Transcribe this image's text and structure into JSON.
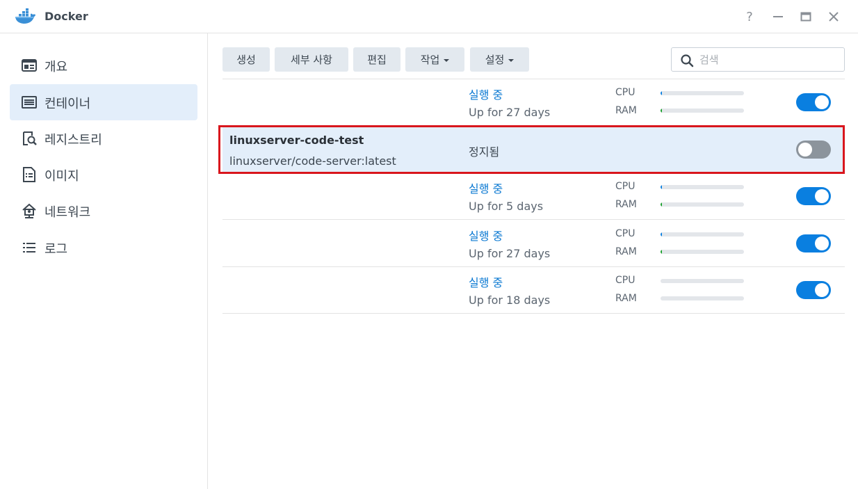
{
  "window": {
    "title": "Docker",
    "help_symbol": "?",
    "icons": [
      "docker-icon",
      "help-icon",
      "minimize-icon",
      "maximize-icon",
      "close-icon"
    ]
  },
  "sidebar": {
    "items": [
      {
        "label": "개요",
        "icon": "overview-icon",
        "active": false
      },
      {
        "label": "컨테이너",
        "icon": "container-list-icon",
        "active": true
      },
      {
        "label": "레지스트리",
        "icon": "registry-search-icon",
        "active": false
      },
      {
        "label": "이미지",
        "icon": "image-file-icon",
        "active": false
      },
      {
        "label": "네트워크",
        "icon": "network-icon",
        "active": false
      },
      {
        "label": "로그",
        "icon": "log-list-icon",
        "active": false
      }
    ]
  },
  "toolbar": {
    "create": "생성",
    "details": "세부 사항",
    "edit": "편집",
    "action": "작업",
    "settings": "설정",
    "search_placeholder": "검색"
  },
  "containers": [
    {
      "name": "",
      "image": "",
      "status": "실행 중",
      "uptime": "Up for 27 days",
      "cpu_label": "CPU",
      "ram_label": "RAM",
      "cpu": 0.01,
      "ram": 0.02,
      "enabled": true
    },
    {
      "name": "linuxserver-code-test",
      "image": "linuxserver/code-server:latest",
      "status": "정지됨",
      "uptime": "",
      "enabled": false,
      "selected": true
    },
    {
      "name": "",
      "image": "",
      "status": "실행 중",
      "uptime": "Up for 5 days",
      "cpu_label": "CPU",
      "ram_label": "RAM",
      "cpu": 0.01,
      "ram": 0.02,
      "enabled": true
    },
    {
      "name": "",
      "image": "",
      "status": "실행 중",
      "uptime": "Up for 27 days",
      "cpu_label": "CPU",
      "ram_label": "RAM",
      "cpu": 0.01,
      "ram": 0.01,
      "enabled": true
    },
    {
      "name": "",
      "image": "",
      "status": "실행 중",
      "uptime": "Up for 18 days",
      "cpu_label": "CPU",
      "ram_label": "RAM",
      "cpu": 0,
      "ram": 0,
      "enabled": true
    }
  ],
  "colors": {
    "accent": "#0a7fe0",
    "running_text": "#0a78d2",
    "cpu_fill": "#0a7fe0",
    "ram_fill": "#19a02c",
    "highlight": "#d9161d",
    "selected_row": "#e3eefa"
  }
}
